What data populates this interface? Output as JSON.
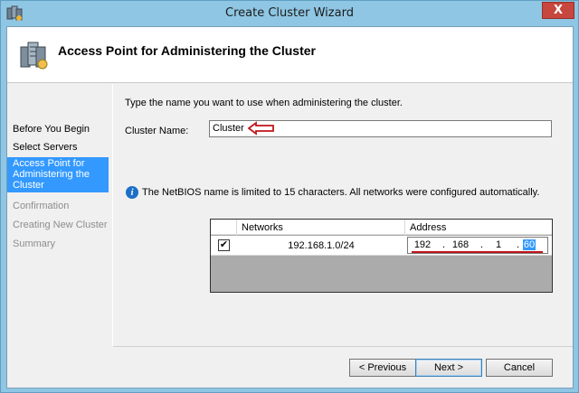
{
  "window": {
    "title": "Create Cluster Wizard",
    "close_glyph": "X"
  },
  "header": {
    "title": "Access Point for Administering the Cluster",
    "icon": "cluster-servers-icon"
  },
  "sidebar": {
    "steps": [
      {
        "label": "Before You Begin",
        "state": "done"
      },
      {
        "label": "Select Servers",
        "state": "done"
      },
      {
        "label": "Access Point for Administering the Cluster",
        "state": "active"
      },
      {
        "label": "Confirmation",
        "state": "pending"
      },
      {
        "label": "Creating New Cluster",
        "state": "pending"
      },
      {
        "label": "Summary",
        "state": "pending"
      }
    ]
  },
  "content": {
    "instructions": "Type the name you want to use when administering the cluster.",
    "cluster_name_label": "Cluster Name:",
    "cluster_name_value": "Cluster",
    "info_text": "The NetBIOS name is limited to 15 characters.  All networks were configured automatically.",
    "grid": {
      "columns": [
        "Networks",
        "Address"
      ],
      "rows": [
        {
          "checked": true,
          "network": "192.168.1.0/24",
          "address": [
            "192",
            "168",
            "1",
            "60"
          ]
        }
      ]
    }
  },
  "buttons": {
    "previous": "< Previous",
    "next": "Next >",
    "cancel": "Cancel"
  },
  "colors": {
    "title_bar": "#8fc6e3",
    "selection": "#3399ff",
    "annotation_red": "#c0141a"
  }
}
